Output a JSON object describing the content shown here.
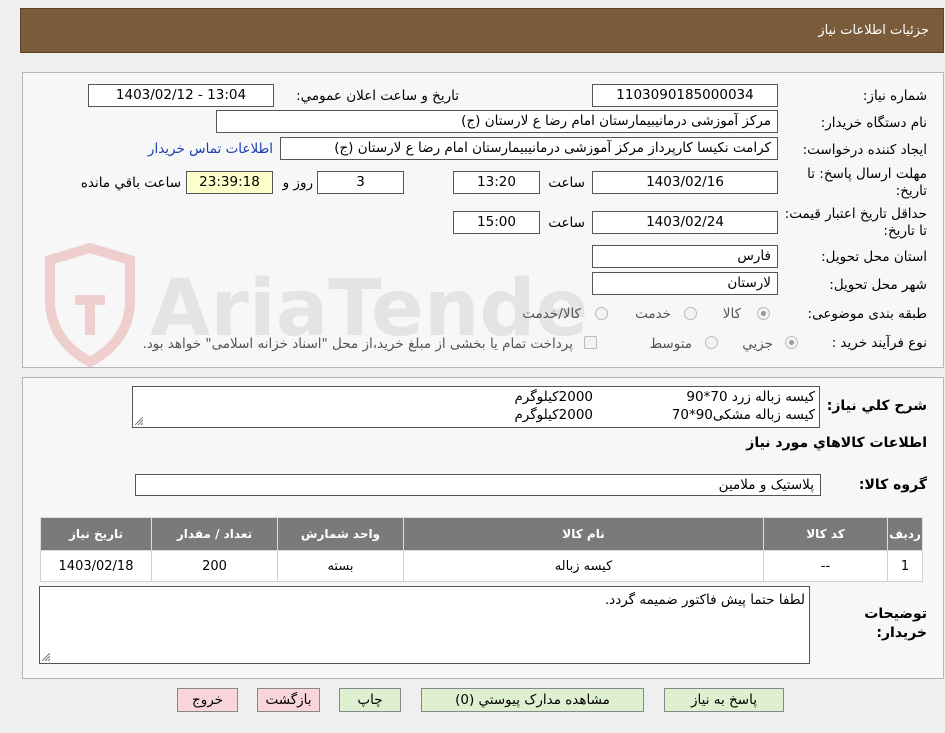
{
  "header": {
    "title": "جزئيات اطلاعات نياز"
  },
  "watermark": {
    "text": "AriaTender.neT"
  },
  "form": {
    "need_number_label": "شماره نياز:",
    "need_number": "1103090185000034",
    "announce_label": "تاريخ و ساعت اعلان عمومي:",
    "announce_value": "1403/02/12 - 13:04",
    "buyer_org_label": "نام دستگاه خريدار:",
    "buyer_org": "مرکز آموزشی درمانیبیمارستان امام رضا  ع  لارستان (ج)",
    "creator_label": "ايجاد کننده درخواست:",
    "creator": "کرامت نکیسا کارپرداز مرکز آموزشی درمانیبیمارستان امام رضا  ع  لارستان (ج)",
    "contact_link": "اطلاعات تماس خريدار",
    "deadline_label": "مهلت ارسال پاسخ: تا تاريخ:",
    "deadline_date": "1403/02/16",
    "time_label": "ساعت",
    "deadline_time": "13:20",
    "days_value": "3",
    "days_label": "روز و",
    "remaining_time": "23:39:18",
    "remaining_label": "ساعت باقي مانده",
    "validity_label": "حداقل تاريخ اعتبار قيمت: تا تاريخ:",
    "validity_date": "1403/02/24",
    "validity_time": "15:00",
    "province_label": "استان محل تحويل:",
    "province": "فارس",
    "city_label": "شهر محل تحويل:",
    "city": "لارستان",
    "category_label": "طبقه بندی موضوعی:",
    "category_options": [
      "کالا",
      "خدمت",
      "کالا/خدمت"
    ],
    "process_label": "نوع فرآيند خريد :",
    "process_options": [
      "جزيي",
      "متوسط"
    ],
    "payment_note": "پرداخت تمام يا بخشی از مبلغ خريد،از محل \"اسناد خزانه اسلامی\" خواهد بود."
  },
  "details": {
    "summary_label": "شرح کلي نياز:",
    "summary_lines": [
      {
        "item": "کیسه زباله زرد 70*90",
        "qty": "2000کیلوگرم"
      },
      {
        "item": "کیسه زباله مشکی90*70",
        "qty": "2000کیلوگرم"
      }
    ],
    "goods_info_title": "اطلاعات کالاهاي مورد نياز",
    "goods_group_label": "گروه کالا:",
    "goods_group": "پلاستیک و ملامین",
    "table": {
      "headers": [
        "رديف",
        "کد کالا",
        "نام کالا",
        "واحد شمارش",
        "تعداد / مقدار",
        "تاريخ نياز"
      ],
      "rows": [
        [
          "1",
          "--",
          "کيسه زباله",
          "بسته",
          "200",
          "1403/02/18"
        ]
      ]
    },
    "buyer_notes_label": "توضيحات خريدار:",
    "buyer_notes": "لطفا حتما پیش فاکتور ضمیمه گردد."
  },
  "buttons": {
    "reply": "پاسخ به نياز",
    "attachments": "مشاهده مدارک پيوستي (0)",
    "print": "چاپ",
    "back": "بازگشت",
    "exit": "خروج"
  }
}
